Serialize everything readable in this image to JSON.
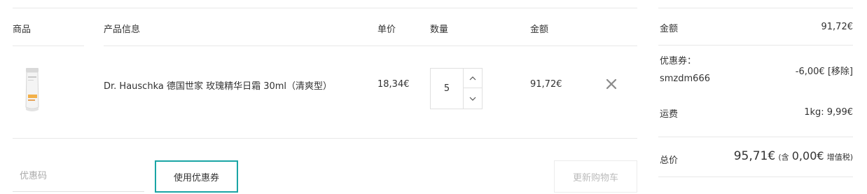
{
  "cart": {
    "headers": {
      "product": "商品",
      "info": "产品信息",
      "unit_price": "单价",
      "quantity": "数量",
      "amount": "金额"
    },
    "item": {
      "name": "Dr. Hauschka 德国世家 玫瑰精华日霜 30ml（清爽型）",
      "unit_price": "18,34€",
      "quantity": "5",
      "subtotal": "91,72€",
      "thumb_icon": "product-tube-image",
      "remove_icon": "close-icon"
    },
    "coupon": {
      "placeholder": "优惠码",
      "apply_label": "使用优惠券"
    },
    "update_label": "更新购物车"
  },
  "summary": {
    "amount_label": "金额",
    "amount_value": "91,72€",
    "coupon_label": "优惠券：",
    "coupon_code": "smzdm666",
    "coupon_value": "-6,00€",
    "coupon_remove": "[移除]",
    "shipping_label": "运费",
    "shipping_value": "1kg: 9,99€",
    "total_label": "总价",
    "total_value": "95,71€",
    "tax_prefix": "(含",
    "tax_value": "0,00€",
    "tax_suffix": "增值税)"
  },
  "colors": {
    "accent": "#1aa5a5",
    "divider": "#e8e8e8",
    "muted": "#bbbbbb"
  }
}
